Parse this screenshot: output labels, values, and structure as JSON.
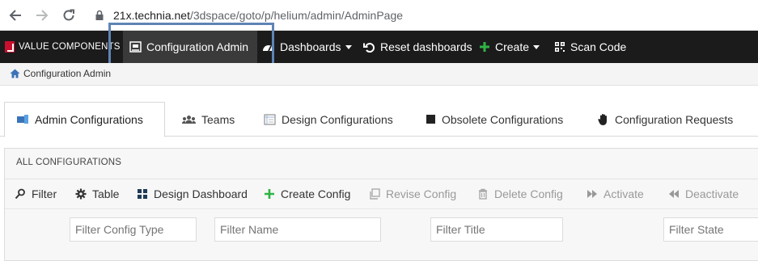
{
  "browser": {
    "url_host": "21x.technia.net",
    "url_path": "/3dspace/goto/p/helium/admin/AdminPage"
  },
  "appbar": {
    "brand": "VALUE COMPONENTS",
    "items": [
      {
        "label": "Configuration Admin",
        "icon": "admin-icon"
      },
      {
        "label": "Dashboards",
        "icon": "dashboard-gauge-icon"
      },
      {
        "label": "Reset dashboards",
        "icon": "reset-icon"
      },
      {
        "label": "Create",
        "icon": "plus-icon"
      },
      {
        "label": "Scan Code",
        "icon": "qr-code-icon"
      }
    ],
    "accent_create": "#2fb344",
    "highlight_color": "#5f84b5"
  },
  "breadcrumb": {
    "label": "Configuration Admin",
    "icon": "home-icon"
  },
  "tabs": [
    {
      "label": "Admin Configurations",
      "icon": "monitor-icon"
    },
    {
      "label": "Teams",
      "icon": "team-icon"
    },
    {
      "label": "Design Configurations",
      "icon": "design-icon"
    },
    {
      "label": "Obsolete Configurations",
      "icon": "square-icon"
    },
    {
      "label": "Configuration Requests",
      "icon": "hand-icon"
    }
  ],
  "panel": {
    "title": "ALL CONFIGURATIONS",
    "toolbar": [
      {
        "label": "Filter",
        "icon": "filter-icon"
      },
      {
        "label": "Table",
        "icon": "gear-icon"
      },
      {
        "label": "Design Dashboard",
        "icon": "grid-icon"
      },
      {
        "label": "Create Config",
        "icon": "plus-icon"
      },
      {
        "label": "Revise Config",
        "icon": "copy-icon"
      },
      {
        "label": "Delete Config",
        "icon": "trash-icon"
      },
      {
        "label": "Activate",
        "icon": "forward-icon"
      },
      {
        "label": "Deactivate",
        "icon": "backward-icon"
      }
    ],
    "filters": [
      {
        "placeholder": "Filter Config Type"
      },
      {
        "placeholder": "Filter Name"
      },
      {
        "placeholder": "Filter Title"
      },
      {
        "placeholder": "Filter State"
      }
    ]
  }
}
